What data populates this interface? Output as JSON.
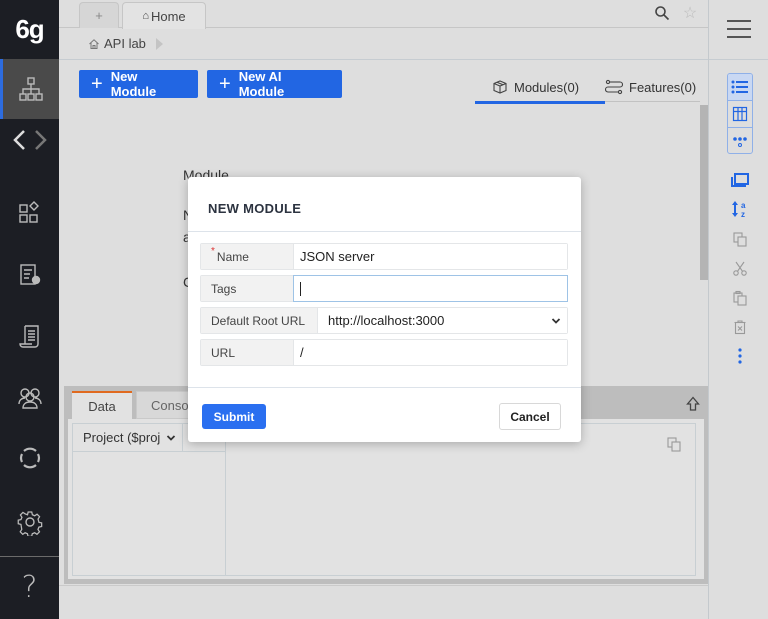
{
  "sidebar": {
    "logo": "6g",
    "items": [
      {
        "name": "sitemap",
        "active": true
      },
      {
        "name": "code-nav"
      },
      {
        "name": "widgets"
      },
      {
        "name": "test-report"
      },
      {
        "name": "scroll-doc"
      },
      {
        "name": "team"
      },
      {
        "name": "sync"
      },
      {
        "name": "settings"
      },
      {
        "name": "help"
      }
    ]
  },
  "tabs": {
    "new_tab_label": "+",
    "home_label": "Home"
  },
  "breadcrumb": {
    "root": "API lab"
  },
  "toolbar": {
    "new_module_label": "New Module",
    "new_ai_module_label": "New AI Module"
  },
  "view_tabs": [
    {
      "label": "Modules(0)",
      "active": true
    },
    {
      "label": "Features(0)",
      "active": false
    }
  ],
  "background_text": {
    "heading": "Module",
    "line1": "N",
    "line2": "a",
    "line3": "C"
  },
  "bottom_panel": {
    "tabs": [
      {
        "label": "Data",
        "active": true
      },
      {
        "label": "Conso",
        "active": false
      }
    ],
    "project_select": "Project ($proj"
  },
  "modal": {
    "title": "NEW MODULE",
    "fields": {
      "name": {
        "label": "Name",
        "value": "JSON server",
        "required": true
      },
      "tags": {
        "label": "Tags",
        "value": ""
      },
      "default_root_url": {
        "label": "Default Root URL",
        "value": "http://localhost:3000"
      },
      "url": {
        "label": "URL",
        "value": "/"
      }
    },
    "submit_label": "Submit",
    "cancel_label": "Cancel"
  },
  "colors": {
    "accent": "#2266e3",
    "sidebar_bg": "#1c1e24",
    "active_tab_indicator": "#e06a1f"
  }
}
